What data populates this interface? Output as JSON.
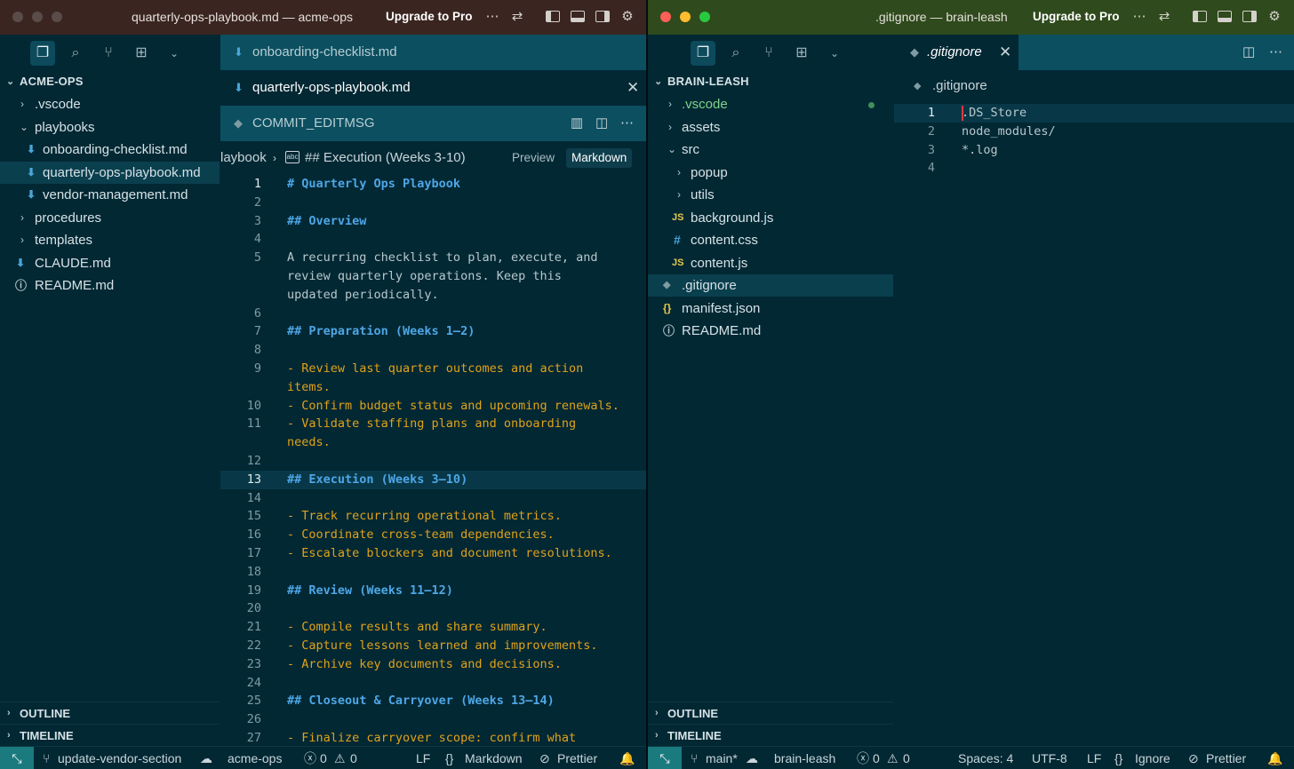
{
  "left": {
    "title": "quarterly-ops-playbook.md — acme-ops",
    "upgrade": "Upgrade to Pro",
    "explorer": {
      "root": "ACME-OPS",
      "items": [
        {
          "label": ".vscode",
          "type": "folder"
        },
        {
          "label": "playbooks",
          "type": "folder-open"
        },
        {
          "label": "onboarding-checklist.md",
          "type": "md"
        },
        {
          "label": "quarterly-ops-playbook.md",
          "type": "md"
        },
        {
          "label": "vendor-management.md",
          "type": "md"
        },
        {
          "label": "procedures",
          "type": "folder"
        },
        {
          "label": "templates",
          "type": "folder"
        },
        {
          "label": "CLAUDE.md",
          "type": "md"
        },
        {
          "label": "README.md",
          "type": "info"
        }
      ]
    },
    "outline": "OUTLINE",
    "timeline": "TIMELINE",
    "tabs": [
      "onboarding-checklist.md",
      "quarterly-ops-playbook.md",
      "COMMIT_EDITMSG"
    ],
    "breadcrumb": {
      "file": "laybook",
      "section": "## Execution (Weeks 3-10)"
    },
    "preview": "Preview",
    "markdown": "Markdown",
    "lines": [
      {
        "n": "1",
        "t": "# Quarterly Ops Playbook",
        "k": "h1"
      },
      {
        "n": "2",
        "t": "",
        "k": "plain"
      },
      {
        "n": "3",
        "t": "## Overview",
        "k": "h2"
      },
      {
        "n": "4",
        "t": "",
        "k": "plain"
      },
      {
        "n": "5",
        "t": "A recurring checklist to plan, execute, and",
        "k": "plain"
      },
      {
        "n": "",
        "t": "review quarterly operations. Keep this",
        "k": "plain"
      },
      {
        "n": "",
        "t": "updated periodically.",
        "k": "plain"
      },
      {
        "n": "6",
        "t": "",
        "k": "plain"
      },
      {
        "n": "7",
        "t": "## Preparation (Weeks 1–2)",
        "k": "h2"
      },
      {
        "n": "8",
        "t": "",
        "k": "plain"
      },
      {
        "n": "9",
        "t": "- Review last quarter outcomes and action",
        "k": "bullet"
      },
      {
        "n": "",
        "t": "items.",
        "k": "bullet"
      },
      {
        "n": "10",
        "t": "- Confirm budget status and upcoming renewals.",
        "k": "bullet"
      },
      {
        "n": "11",
        "t": "- Validate staffing plans and onboarding",
        "k": "bullet"
      },
      {
        "n": "",
        "t": "needs.",
        "k": "bullet"
      },
      {
        "n": "12",
        "t": "",
        "k": "plain"
      },
      {
        "n": "13",
        "t": "## Execution (Weeks 3–10)",
        "k": "h2"
      },
      {
        "n": "14",
        "t": "",
        "k": "plain"
      },
      {
        "n": "15",
        "t": "- Track recurring operational metrics.",
        "k": "bullet"
      },
      {
        "n": "16",
        "t": "- Coordinate cross-team dependencies.",
        "k": "bullet"
      },
      {
        "n": "17",
        "t": "- Escalate blockers and document resolutions.",
        "k": "bullet"
      },
      {
        "n": "18",
        "t": "",
        "k": "plain"
      },
      {
        "n": "19",
        "t": "## Review (Weeks 11–12)",
        "k": "h2"
      },
      {
        "n": "20",
        "t": "",
        "k": "plain"
      },
      {
        "n": "21",
        "t": "- Compile results and share summary.",
        "k": "bullet"
      },
      {
        "n": "22",
        "t": "- Capture lessons learned and improvements.",
        "k": "bullet"
      },
      {
        "n": "23",
        "t": "- Archive key documents and decisions.",
        "k": "bullet"
      },
      {
        "n": "24",
        "t": "",
        "k": "plain"
      },
      {
        "n": "25",
        "t": "## Closeout & Carryover (Weeks 13–14)",
        "k": "h2"
      },
      {
        "n": "26",
        "t": "",
        "k": "plain"
      },
      {
        "n": "27",
        "t": "- Finalize carryover scope: confirm what",
        "k": "bullet"
      }
    ],
    "status": {
      "branch": "update-vendor-section",
      "repo": "acme-ops",
      "errors": "0",
      "warnings": "0",
      "eol": "LF",
      "language": "Markdown",
      "formatter": "Prettier"
    }
  },
  "right": {
    "title": ".gitignore — brain-leash",
    "upgrade": "Upgrade to Pro",
    "explorer": {
      "root": "BRAIN-LEASH",
      "items": [
        {
          "label": ".vscode",
          "type": "folder"
        },
        {
          "label": "assets",
          "type": "folder"
        },
        {
          "label": "src",
          "type": "folder-open"
        },
        {
          "label": "popup",
          "type": "folder"
        },
        {
          "label": "utils",
          "type": "folder"
        },
        {
          "label": "background.js",
          "type": "js",
          "icon": "JS"
        },
        {
          "label": "content.css",
          "type": "css",
          "icon": "#"
        },
        {
          "label": "content.js",
          "type": "js",
          "icon": "JS"
        },
        {
          "label": ".gitignore",
          "type": "git"
        },
        {
          "label": "manifest.json",
          "type": "json",
          "icon": "{}"
        },
        {
          "label": "README.md",
          "type": "info"
        }
      ]
    },
    "outline": "OUTLINE",
    "timeline": "TIMELINE",
    "tab": ".gitignore",
    "breadcrumb": ".gitignore",
    "lines": [
      {
        "n": "1",
        "t": ".DS_Store"
      },
      {
        "n": "2",
        "t": "node_modules/"
      },
      {
        "n": "3",
        "t": "*.log"
      },
      {
        "n": "4",
        "t": ""
      }
    ],
    "status": {
      "branch": "main*",
      "repo": "brain-leash",
      "errors": "0",
      "warnings": "0",
      "spaces": "Spaces: 4",
      "encoding": "UTF-8",
      "eol": "LF",
      "language": "Ignore",
      "formatter": "Prettier"
    }
  },
  "colors": {
    "accent": "#4ea6e6",
    "bullet": "#e0a21a",
    "background": "#022834",
    "remote": "#1a7a7e"
  }
}
